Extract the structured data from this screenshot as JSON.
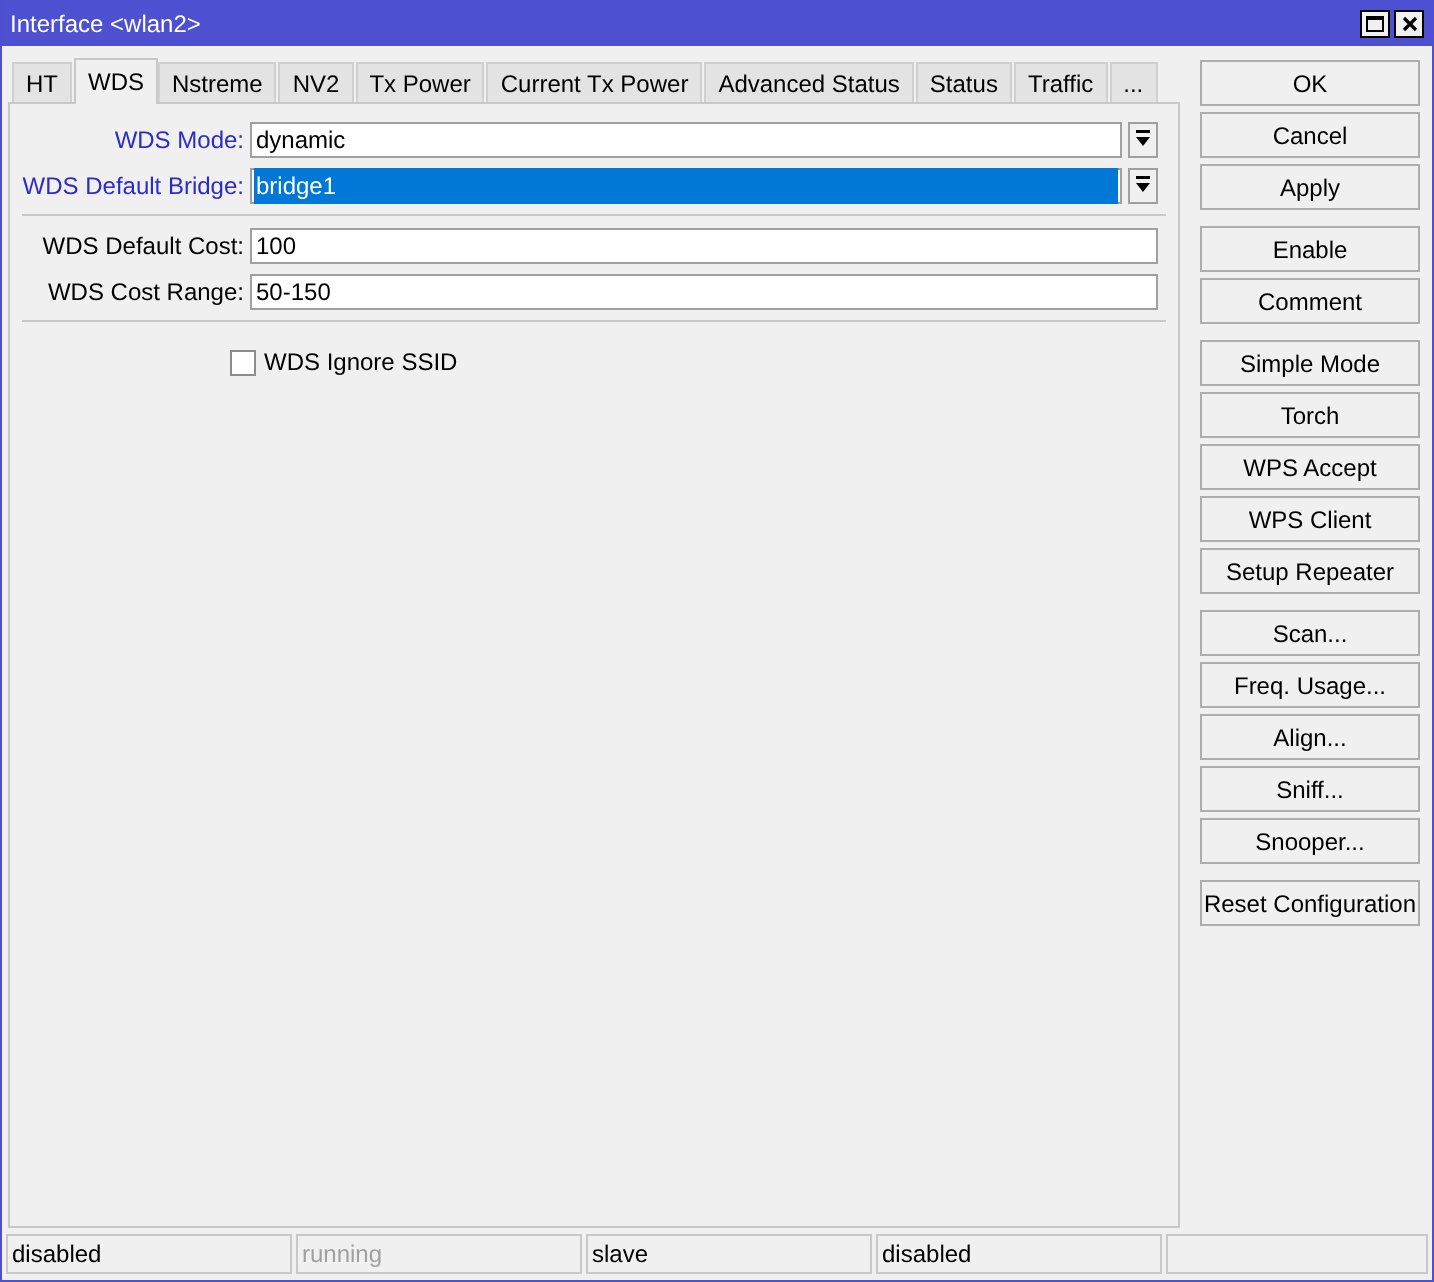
{
  "window": {
    "title": "Interface <wlan2>"
  },
  "tabs": [
    {
      "label": "HT",
      "selected": false
    },
    {
      "label": "WDS",
      "selected": true
    },
    {
      "label": "Nstreme",
      "selected": false
    },
    {
      "label": "NV2",
      "selected": false
    },
    {
      "label": "Tx Power",
      "selected": false
    },
    {
      "label": "Current Tx Power",
      "selected": false
    },
    {
      "label": "Advanced Status",
      "selected": false
    },
    {
      "label": "Status",
      "selected": false
    },
    {
      "label": "Traffic",
      "selected": false
    },
    {
      "label": "...",
      "selected": false
    }
  ],
  "field_groups": [
    [
      {
        "label": "WDS Mode:",
        "kind": "dropdown",
        "value": "dynamic",
        "highlighted_label": true,
        "selected": false
      },
      {
        "label": "WDS Default Bridge:",
        "kind": "dropdown",
        "value": "bridge1",
        "highlighted_label": true,
        "selected": true
      }
    ],
    [
      {
        "label": "WDS Default Cost:",
        "kind": "text",
        "value": "100",
        "highlighted_label": false,
        "selected": false
      },
      {
        "label": "WDS Cost Range:",
        "kind": "text",
        "value": "50-150",
        "highlighted_label": false,
        "selected": false
      }
    ]
  ],
  "checkboxes": [
    {
      "label": "WDS Ignore SSID",
      "checked": false
    }
  ],
  "button_groups": [
    [
      "OK",
      "Cancel",
      "Apply"
    ],
    [
      "Enable",
      "Comment"
    ],
    [
      "Simple Mode",
      "Torch",
      "WPS Accept",
      "WPS Client",
      "Setup Repeater"
    ],
    [
      "Scan...",
      "Freq. Usage...",
      "Align...",
      "Sniff...",
      "Snooper..."
    ],
    [
      "Reset Configuration"
    ]
  ],
  "status_bar": [
    {
      "text": "disabled",
      "disabled": false
    },
    {
      "text": "running",
      "disabled": true
    },
    {
      "text": "slave",
      "disabled": false
    },
    {
      "text": "disabled",
      "disabled": false
    }
  ]
}
